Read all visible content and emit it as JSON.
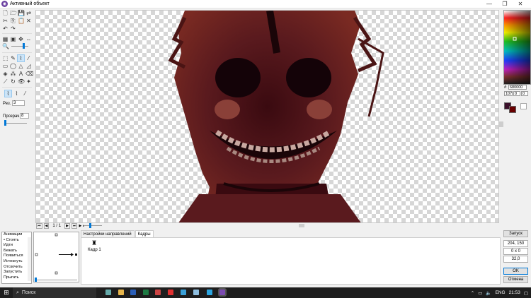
{
  "window": {
    "title": "Активный объект",
    "app_icon": "app-icon"
  },
  "toolbox": {
    "speed_label": "Рез.",
    "speed_value": "3",
    "opacity_label": "Прозрач.",
    "opacity_value": "8"
  },
  "palette": {
    "hex_value": "680000",
    "rgb": [
      "107",
      "0",
      "0"
    ],
    "primary_color": "#680000",
    "secondary_color": "#3a0f2a"
  },
  "frame_nav": {
    "counter": "1 / 1"
  },
  "animations": {
    "header": "Анимации",
    "items": [
      "• Стоять",
      "Идти",
      "Бежать",
      "Появиться",
      "Исчезнуть",
      "Отскочить",
      "Запустить",
      "Прыгать"
    ]
  },
  "tabs": [
    "Настройки направлений",
    "Кадры"
  ],
  "frames": [
    {
      "label": "Кадр 1"
    }
  ],
  "right_panel": {
    "launch": "Запуск",
    "position": "204, 150",
    "size": "0 x 0",
    "zoom": "32,0",
    "ok": "OK",
    "cancel": "Отмена"
  },
  "taskbar": {
    "search": "Поиск",
    "lang": "ENG",
    "time": "21:53"
  }
}
